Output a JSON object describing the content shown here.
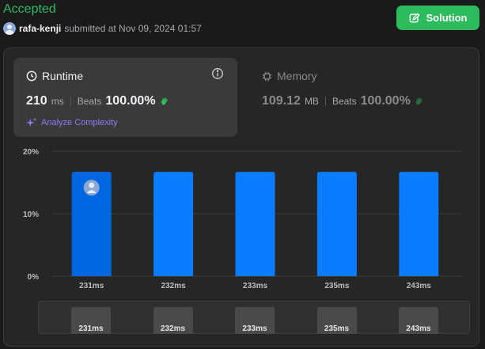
{
  "header": {
    "status": "Accepted",
    "username": "rafa-kenji",
    "submitted_text": "submitted at Nov 09, 2024 01:57",
    "solution_label": "Solution"
  },
  "runtime": {
    "title": "Runtime",
    "value": "210",
    "unit": "ms",
    "beats_label": "Beats",
    "beats_pct": "100.00%",
    "analyze_label": "Analyze Complexity"
  },
  "memory": {
    "title": "Memory",
    "value": "109.12",
    "unit": "MB",
    "beats_label": "Beats",
    "beats_pct": "100.00%"
  },
  "colors": {
    "accepted": "#2cbb5d",
    "bar": "#0a7cff",
    "bar_selected": "#0067e0",
    "accent_purple": "#8b7cf6"
  },
  "chart_data": {
    "type": "bar",
    "categories": [
      "231ms",
      "232ms",
      "233ms",
      "235ms",
      "243ms"
    ],
    "values": [
      16.7,
      16.7,
      16.7,
      16.7,
      16.7
    ],
    "yticks": [
      "0%",
      "10%",
      "20%"
    ],
    "ylim": [
      0,
      20
    ],
    "grid": true,
    "selected_index": 0
  },
  "scrubber": {
    "labels": [
      "231ms",
      "232ms",
      "233ms",
      "235ms",
      "243ms"
    ]
  }
}
